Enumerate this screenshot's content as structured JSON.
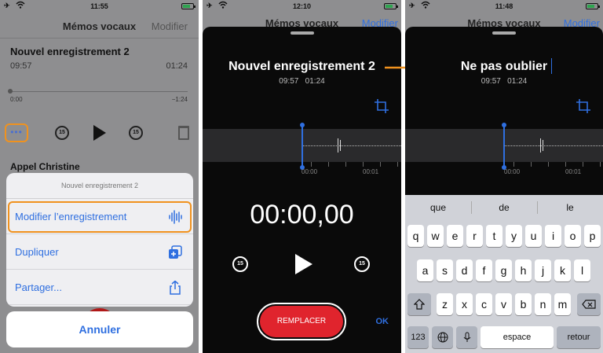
{
  "panel1": {
    "status_time": "11:55",
    "nav_title": "Mémos vocaux",
    "nav_edit": "Modifier",
    "recording": {
      "title": "Nouvel enregistrement 2",
      "time": "09:57",
      "duration": "01:24",
      "scrub_start": "0:00",
      "scrub_end": "−1:24"
    },
    "more_label": "•••",
    "skip_back": "15",
    "skip_forward": "15",
    "next_recording": "Appel Christine",
    "sheet": {
      "title": "Nouvel enregistrement 2",
      "items": [
        {
          "label": "Modifier l’enregistrement",
          "icon": "waveform-icon"
        },
        {
          "label": "Dupliquer",
          "icon": "duplicate-icon"
        },
        {
          "label": "Partager...",
          "icon": "share-icon"
        }
      ]
    },
    "cancel": "Annuler"
  },
  "panel2": {
    "status_time": "12:10",
    "bg_title": "Mémos vocaux",
    "bg_edit": "Modifier",
    "title": "Nouvel enregistrement 2",
    "time": "09:57",
    "duration": "01:24",
    "tick_labels": [
      "00:00",
      "00:01"
    ],
    "timer": "00:00,00",
    "skip_back": "15",
    "skip_forward": "15",
    "replace": "REMPLACER",
    "ok": "OK"
  },
  "panel3": {
    "status_time": "11:48",
    "bg_title": "Mémos vocaux",
    "bg_edit": "Modifier",
    "title": "Ne pas oublier",
    "time": "09:57",
    "duration": "01:24",
    "tick_labels": [
      "00:00",
      "00:01"
    ],
    "suggestions": [
      "que",
      "de",
      "le"
    ],
    "rows": [
      [
        "q",
        "w",
        "e",
        "r",
        "t",
        "y",
        "u",
        "i",
        "o",
        "p"
      ],
      [
        "a",
        "s",
        "d",
        "f",
        "g",
        "h",
        "j",
        "k",
        "l"
      ],
      [
        "z",
        "x",
        "c",
        "v",
        "b",
        "n",
        "m"
      ]
    ],
    "key_123": "123",
    "key_space": "espace",
    "key_return": "retour"
  },
  "colors": {
    "accent": "#2f6fe0",
    "highlight": "#f0921e",
    "record_red": "#e0242d"
  }
}
